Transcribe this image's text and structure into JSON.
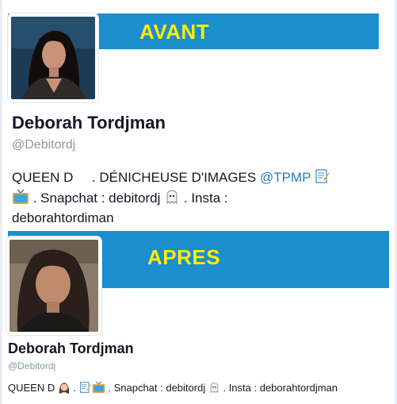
{
  "before": {
    "banner_label": "AVANT",
    "profile": {
      "name": "Deborah Tordjman",
      "handle": "@Debitordj",
      "bio_queen": "QUEEN D",
      "bio_role": ". DÉNICHEUSE D'IMAGES",
      "bio_link": "@TPMP",
      "bio_snapchat": ". Snapchat : debitordj",
      "bio_insta_label": ". Insta :",
      "bio_insta_handle": "deborahtordiman"
    }
  },
  "after": {
    "banner_label": "APRES",
    "profile": {
      "name": "Deborah Tordjman",
      "handle": "@Debitordj",
      "bio_queen": "QUEEN D",
      "bio_dot": ".",
      "bio_snapchat": ". Snapchat : debitordj",
      "bio_insta": ". Insta : deborahtordjman"
    }
  },
  "colors": {
    "banner": "#1b8ecd",
    "banner_text": "#ffee00",
    "link": "#2b7bb9",
    "handle": "#8899a6"
  },
  "icons": [
    "memo-icon",
    "tv-icon",
    "ghost-icon",
    "woman-icon"
  ]
}
